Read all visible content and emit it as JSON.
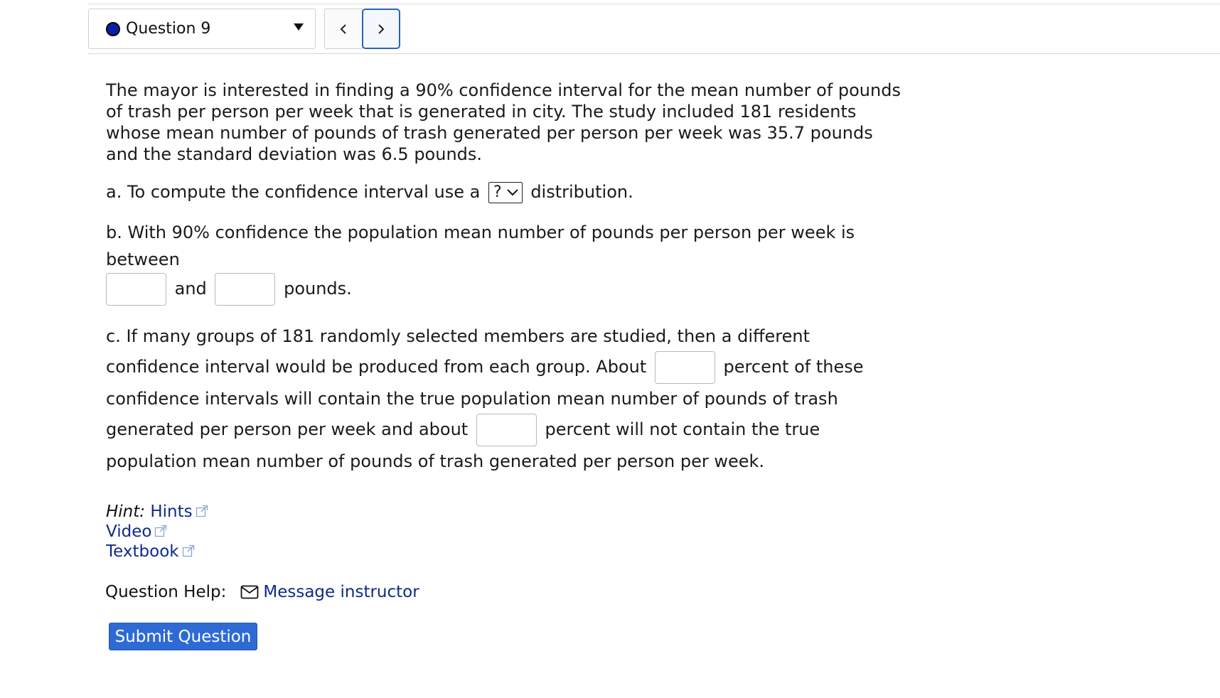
{
  "header": {
    "question_label": "Question 9",
    "prev_symbol": "<",
    "next_symbol": ">"
  },
  "problem": {
    "intro": "The mayor is interested in finding a 90% confidence interval for the mean number of pounds of trash per person per week that is generated in city. The study included 181 residents whose mean number of pounds of trash generated per person per week was 35.7 pounds and the standard deviation was 6.5 pounds.",
    "part_a_before": "a. To compute the confidence interval use a",
    "part_a_select_value": "?",
    "part_a_after": "distribution.",
    "part_b_before": "b. With 90% confidence the population mean number of pounds per person per week is between",
    "part_b_and": "and",
    "part_b_after": "pounds.",
    "part_c_1": "c. If many groups of 181 randomly selected members are studied, then a different confidence interval would be produced from each group. About",
    "part_c_2": "percent of these confidence intervals will contain the true population mean number of pounds of trash generated per person per week and about",
    "part_c_3": "percent will not contain the true population mean number of pounds of trash generated per person per week."
  },
  "links": {
    "hint_label": "Hint:",
    "hints": "Hints",
    "video": "Video",
    "textbook": "Textbook"
  },
  "help": {
    "label": "Question Help:",
    "message_instructor": "Message instructor"
  },
  "submit_label": "Submit Question",
  "colors": {
    "accent": "#2e6ad4",
    "link": "#0f2a8c",
    "status_dot": "#0b1ea8"
  }
}
